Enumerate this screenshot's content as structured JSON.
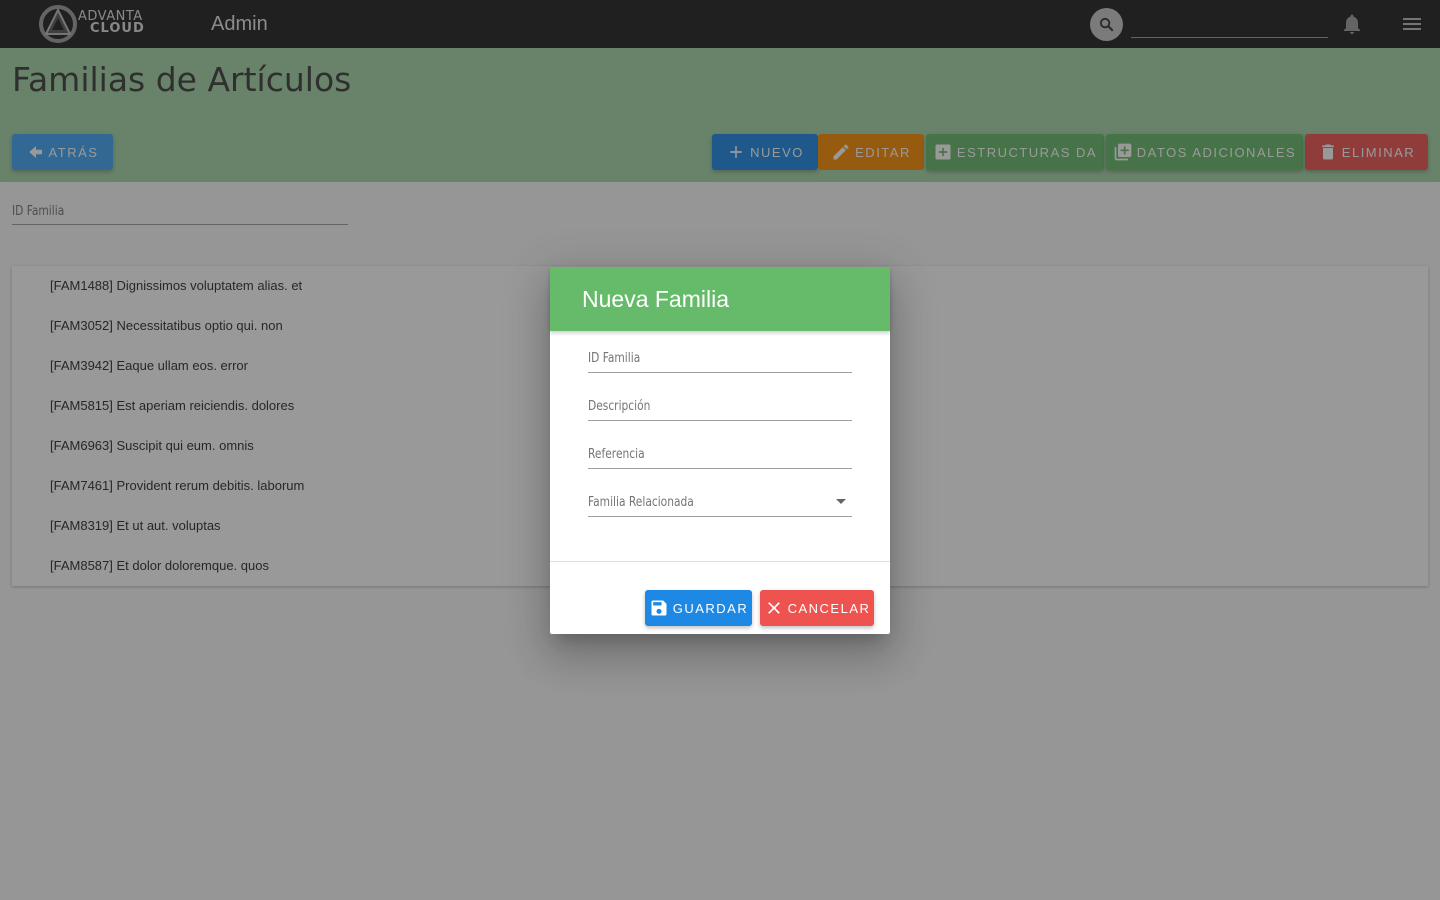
{
  "app": {
    "logo_line1": "ADVANTA",
    "logo_line2": "CLOUD",
    "section": "Admin"
  },
  "header": {
    "search_placeholder": "",
    "search_value": ""
  },
  "page": {
    "title": "Familias de Artículos",
    "back_label": "Atrás",
    "new_label": "Nuevo",
    "edit_label": "Editar",
    "structures_label": "Estructuras DA",
    "extra_data_label": "Datos Adicionales",
    "delete_label": "Eliminar"
  },
  "filter": {
    "label": "ID Familia"
  },
  "families": [
    "[FAM1488] Dignissimos voluptatem alias. et",
    "[FAM3052] Necessitatibus optio qui. non",
    "[FAM3942] Eaque ullam eos. error",
    "[FAM5815] Est aperiam reiciendis. dolores",
    "[FAM6963] Suscipit qui eum. omnis",
    "[FAM7461] Provident rerum debitis. laborum",
    "[FAM8319] Et ut aut. voluptas",
    "[FAM8587] Et dolor doloremque. quos"
  ],
  "dialog": {
    "title": "Nueva Familia",
    "fields": {
      "id_label": "ID Familia",
      "description_label": "Descripción",
      "reference_label": "Referencia",
      "related_label": "Familia Relacionada"
    },
    "save_label": "Guardar",
    "cancel_label": "Cancelar"
  },
  "colors": {
    "topbar": "#212121",
    "header_green": "#a5d6a7",
    "dialog_green": "#66bb6a",
    "primary_blue": "#1e88e5",
    "back_blue": "#42a5f5",
    "edit_orange": "#fb8c00",
    "delete_red": "#ef5350"
  },
  "icons": {
    "logo": "advanta-logo-icon",
    "search": "search-icon",
    "notifications": "bell-icon",
    "menu": "hamburger-menu-icon",
    "back": "arrow-left-icon",
    "new": "plus-icon",
    "edit": "pencil-icon",
    "structures": "add-box-icon",
    "extra": "library-add-icon",
    "delete": "trash-icon",
    "save": "floppy-disk-icon",
    "cancel": "close-icon"
  }
}
